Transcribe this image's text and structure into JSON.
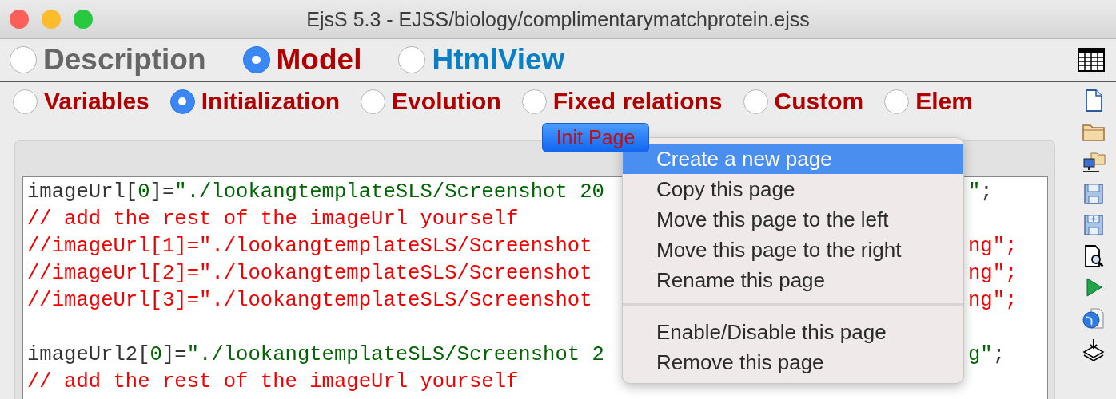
{
  "window": {
    "title": "EjsS 5.3 - EJSS/biology/complimentarymatchprotein.ejss"
  },
  "main_tabs": [
    {
      "label": "Description",
      "selected": false,
      "color": "#666666"
    },
    {
      "label": "Model",
      "selected": true,
      "color": "#b00000"
    },
    {
      "label": "HtmlView",
      "selected": false,
      "color": "#0a7fc4"
    }
  ],
  "sub_tabs": [
    {
      "label": "Variables",
      "selected": false
    },
    {
      "label": "Initialization",
      "selected": true
    },
    {
      "label": "Evolution",
      "selected": false
    },
    {
      "label": "Fixed relations",
      "selected": false
    },
    {
      "label": "Custom",
      "selected": false
    },
    {
      "label": "Elem",
      "selected": false
    }
  ],
  "page_button": "Init Page",
  "code_lines": [
    {
      "kind": "code",
      "segments": [
        {
          "kind": "plain",
          "text": "imageUrl["
        },
        {
          "kind": "number",
          "text": "0"
        },
        {
          "kind": "plain",
          "text": "]="
        },
        {
          "kind": "string",
          "text": "\"./lookangtemplateSLS/Screenshot 20"
        }
      ],
      "tail": [
        {
          "kind": "string",
          "text": "\""
        },
        {
          "kind": "plain",
          "text": ";"
        }
      ]
    },
    {
      "kind": "code",
      "segments": [
        {
          "kind": "comment",
          "text": "// add the rest of the imageUrl yourself"
        }
      ]
    },
    {
      "kind": "code",
      "segments": [
        {
          "kind": "comment",
          "text": "//imageUrl[1]=\"./lookangtemplateSLS/Screenshot"
        }
      ],
      "tail": [
        {
          "kind": "comment",
          "text": "ng\";"
        }
      ]
    },
    {
      "kind": "code",
      "segments": [
        {
          "kind": "comment",
          "text": "//imageUrl[2]=\"./lookangtemplateSLS/Screenshot"
        }
      ],
      "tail": [
        {
          "kind": "comment",
          "text": "ng\";"
        }
      ]
    },
    {
      "kind": "code",
      "segments": [
        {
          "kind": "comment",
          "text": "//imageUrl[3]=\"./lookangtemplateSLS/Screenshot"
        }
      ],
      "tail": [
        {
          "kind": "comment",
          "text": "ng\";"
        }
      ]
    },
    {
      "kind": "blank"
    },
    {
      "kind": "code",
      "segments": [
        {
          "kind": "plain",
          "text": "imageUrl2["
        },
        {
          "kind": "number",
          "text": "0"
        },
        {
          "kind": "plain",
          "text": "]="
        },
        {
          "kind": "string",
          "text": "\"./lookangtemplateSLS/Screenshot 2"
        }
      ],
      "tail": [
        {
          "kind": "string",
          "text": "g\""
        },
        {
          "kind": "plain",
          "text": ";"
        }
      ]
    },
    {
      "kind": "code",
      "segments": [
        {
          "kind": "comment",
          "text": "// add the rest of the imageUrl yourself"
        }
      ]
    }
  ],
  "context_menu": {
    "groups": [
      [
        {
          "label": "Create a new page",
          "selected": true
        },
        {
          "label": "Copy this page",
          "selected": false
        },
        {
          "label": "Move this page to the left",
          "selected": false
        },
        {
          "label": "Move this page to the right",
          "selected": false
        },
        {
          "label": "Rename this page",
          "selected": false
        }
      ],
      [
        {
          "label": "Enable/Disable this page",
          "selected": false
        },
        {
          "label": "Remove this page",
          "selected": false
        }
      ]
    ]
  }
}
